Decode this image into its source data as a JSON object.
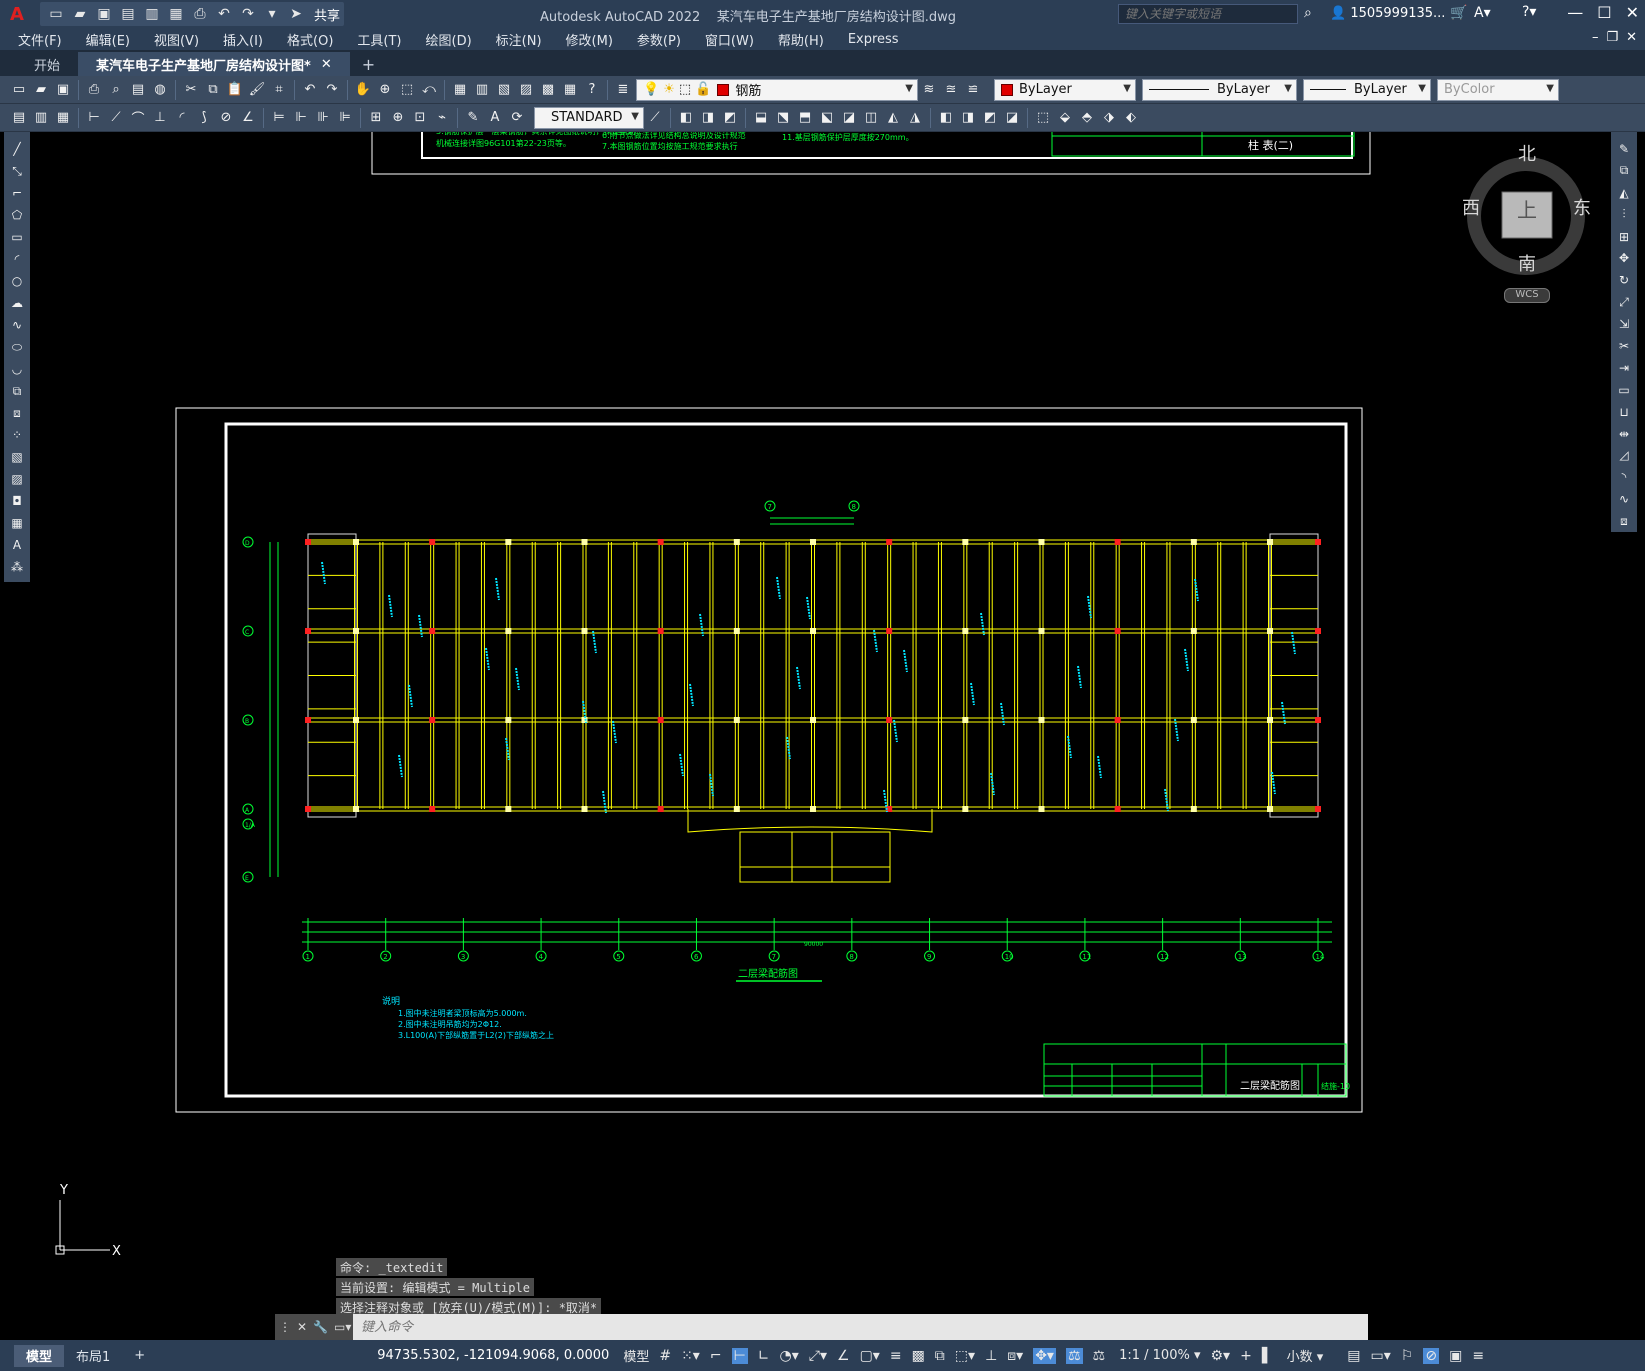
{
  "window": {
    "app_title": "Autodesk AutoCAD 2022",
    "file_title": "某汽车电子生产基地厂房结构设计图.dwg",
    "search_placeholder": "键入关键字或短语",
    "user": "1505999135...",
    "share_label": "共享"
  },
  "menu": [
    "文件(F)",
    "编辑(E)",
    "视图(V)",
    "插入(I)",
    "格式(O)",
    "工具(T)",
    "绘图(D)",
    "标注(N)",
    "修改(M)",
    "参数(P)",
    "窗口(W)",
    "帮助(H)",
    "Express"
  ],
  "tabs": {
    "start": "开始",
    "active": "某汽车电子生产基地厂房结构设计图*"
  },
  "properties": {
    "layer": "钢筋",
    "color": "ByLayer",
    "linetype": "ByLayer",
    "lineweight": "ByLayer",
    "plotstyle": "ByColor",
    "text_style": "STANDARD"
  },
  "viewcube": {
    "north": "北",
    "south": "南",
    "east": "东",
    "west": "西",
    "top": "上",
    "wcs": "WCS"
  },
  "drawing": {
    "title_top_block": "柱 表(二)",
    "plan_title": "二层梁配筋图",
    "notes_title": "说明",
    "notes": [
      "1.图中未注明者梁顶标高为5.000m.",
      "2.图中未注明吊筋均为2Φ12.",
      "3.L100(A)下部纵筋置于L2(2)下部纵筋之上"
    ],
    "title_block_name": "二层梁配筋图",
    "title_block_code": "结施-10",
    "axis_letters": [
      "D",
      "C",
      "B",
      "A",
      "1/A",
      "E"
    ],
    "axis_numbers": [
      "1",
      "2",
      "3",
      "4",
      "5",
      "6",
      "7",
      "8",
      "9",
      "10",
      "11",
      "12",
      "13",
      "14"
    ],
    "total_dim": "90000"
  },
  "command": {
    "history": [
      "命令: _textedit",
      "当前设置: 编辑模式 = Multiple",
      "选择注释对象或 [放弃(U)/模式(M)]: *取消*"
    ],
    "placeholder": "键入命令"
  },
  "status": {
    "layout_tabs": [
      "模型",
      "布局1"
    ],
    "coords": "94735.5302, -121094.9068, 0.0000",
    "space": "模型",
    "scale": "1:1 / 100%",
    "units": "小数"
  },
  "colors": {
    "beam": "#ffff00",
    "annotation": "#00ff33",
    "text_cyan": "#00e5ff",
    "column_red": "#ff2020",
    "frame": "#ffffff"
  }
}
